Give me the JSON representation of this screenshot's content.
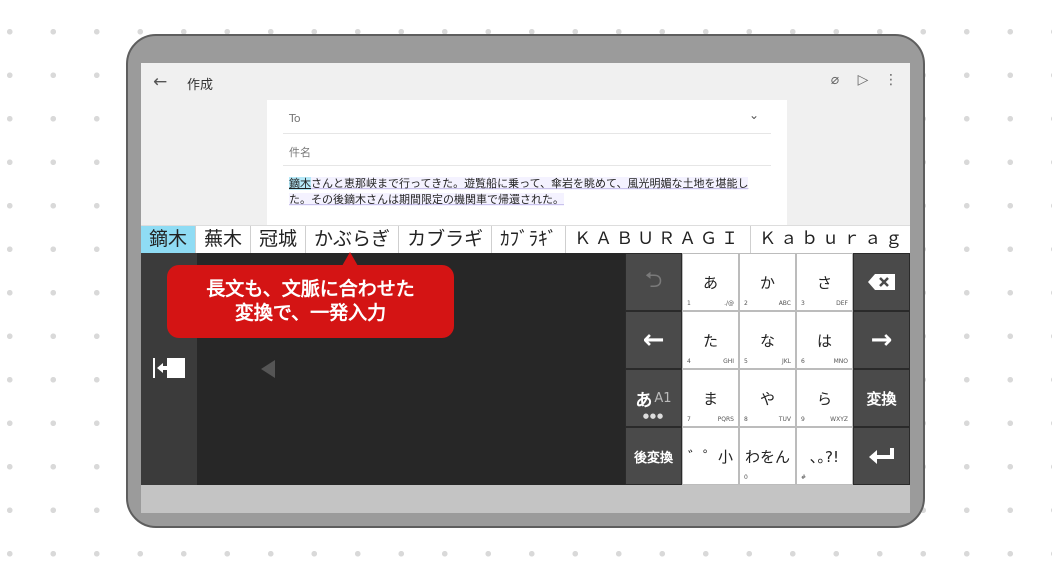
{
  "appbar": {
    "back_icon": "←",
    "title": "作成",
    "attach_icon": "⌀",
    "send_icon": "▷",
    "more_icon": "⋮"
  },
  "compose": {
    "to_label": "To",
    "to_chevron": "⌄",
    "subject_label": "件名",
    "body_highlight": "鏑木",
    "body_rest": "さんと恵那峡まで行ってきた。遊覧船に乗って、傘岩を眺めて、風光明媚な土地を堪能した。その後鏑木さんは期間限定の機関車で帰還された。"
  },
  "candidates": [
    "鏑木",
    "蕪木",
    "冠城",
    "かぶらぎ",
    "カブラギ",
    "ｶﾌﾞﾗｷﾞ",
    "ＫＡＢＵＲＡＧＩ",
    "Ｋａｂｕｒａｇ"
  ],
  "callout": {
    "line1": "長文も、文脈に合わせた",
    "line2": "変換で、一発入力"
  },
  "keyboard": {
    "undo_icon": "⮌",
    "backspace_icon": "⌫",
    "left_arrow": "←",
    "right_arrow": "→",
    "henkan": "変換",
    "mode_main": "あ",
    "mode_sub": "A1",
    "mode_dots": "●●●",
    "gohenkan": "後変換",
    "enter_icon": "↵",
    "keys": [
      {
        "main": "あ",
        "num": "1",
        "sub": "./@"
      },
      {
        "main": "か",
        "num": "2",
        "sub": "ABC"
      },
      {
        "main": "さ",
        "num": "3",
        "sub": "DEF"
      },
      {
        "main": "た",
        "num": "4",
        "sub": "GHI"
      },
      {
        "main": "な",
        "num": "5",
        "sub": "JKL"
      },
      {
        "main": "は",
        "num": "6",
        "sub": "MNO"
      },
      {
        "main": "ま",
        "num": "7",
        "sub": "PQRS"
      },
      {
        "main": "や",
        "num": "8",
        "sub": "TUV"
      },
      {
        "main": "ら",
        "num": "9",
        "sub": "WXYZ"
      },
      {
        "main": "゛゜小",
        "num": "",
        "sub": ""
      },
      {
        "main": "わをん",
        "num": "0",
        "sub": ""
      },
      {
        "main": "､｡?!",
        "num": "#",
        "sub": ""
      }
    ]
  }
}
